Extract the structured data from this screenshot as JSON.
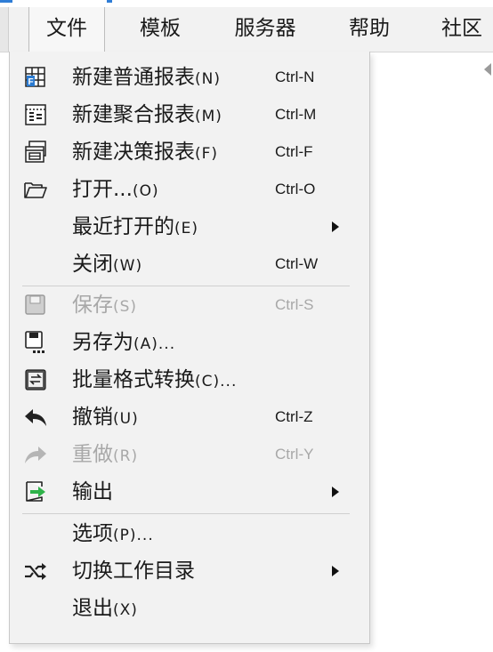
{
  "menubar": {
    "items": [
      {
        "label": "文件",
        "active": true
      },
      {
        "label": "模板"
      },
      {
        "label": "服务器"
      },
      {
        "label": "帮助"
      },
      {
        "label": "社区"
      }
    ]
  },
  "file_menu": {
    "items": [
      {
        "label": "新建普通报表",
        "mnemonic": "(N)",
        "shortcut": "Ctrl-N",
        "icon": "new-report-grid-icon"
      },
      {
        "label": "新建聚合报表",
        "mnemonic": "(M)",
        "shortcut": "Ctrl-M",
        "icon": "aggregate-report-icon"
      },
      {
        "label": "新建决策报表",
        "mnemonic": "(F)",
        "shortcut": "Ctrl-F",
        "icon": "decision-report-icon"
      },
      {
        "label": "打开...",
        "mnemonic": "(O)",
        "shortcut": "Ctrl-O",
        "icon": "folder-open-icon"
      },
      {
        "label": "最近打开的",
        "mnemonic": "(E)",
        "submenu": true
      },
      {
        "label": "关闭",
        "mnemonic": "(W)",
        "shortcut": "Ctrl-W"
      },
      {
        "label": "保存",
        "mnemonic": "(S)",
        "shortcut": "Ctrl-S",
        "icon": "save-icon",
        "disabled": true
      },
      {
        "label": "另存为",
        "mnemonic": "(A)...",
        "icon": "save-as-icon"
      },
      {
        "label": "批量格式转换",
        "mnemonic": "(C)...",
        "icon": "batch-convert-icon"
      },
      {
        "label": "撤销",
        "mnemonic": "(U)",
        "shortcut": "Ctrl-Z",
        "icon": "undo-icon"
      },
      {
        "label": "重做",
        "mnemonic": "(R)",
        "shortcut": "Ctrl-Y",
        "icon": "redo-icon",
        "disabled": true
      },
      {
        "label": "输出",
        "submenu": true,
        "icon": "export-icon"
      },
      {
        "label": "选项",
        "mnemonic": "(P)..."
      },
      {
        "label": "切换工作目录",
        "submenu": true,
        "icon": "shuffle-icon"
      },
      {
        "label": "退出",
        "mnemonic": "(X)"
      }
    ]
  },
  "colors": {
    "accent": "#2f7dd6",
    "menu_bg": "#f2f2f2",
    "disabled_text": "#a8a8a8",
    "export_green": "#2fb34a"
  }
}
